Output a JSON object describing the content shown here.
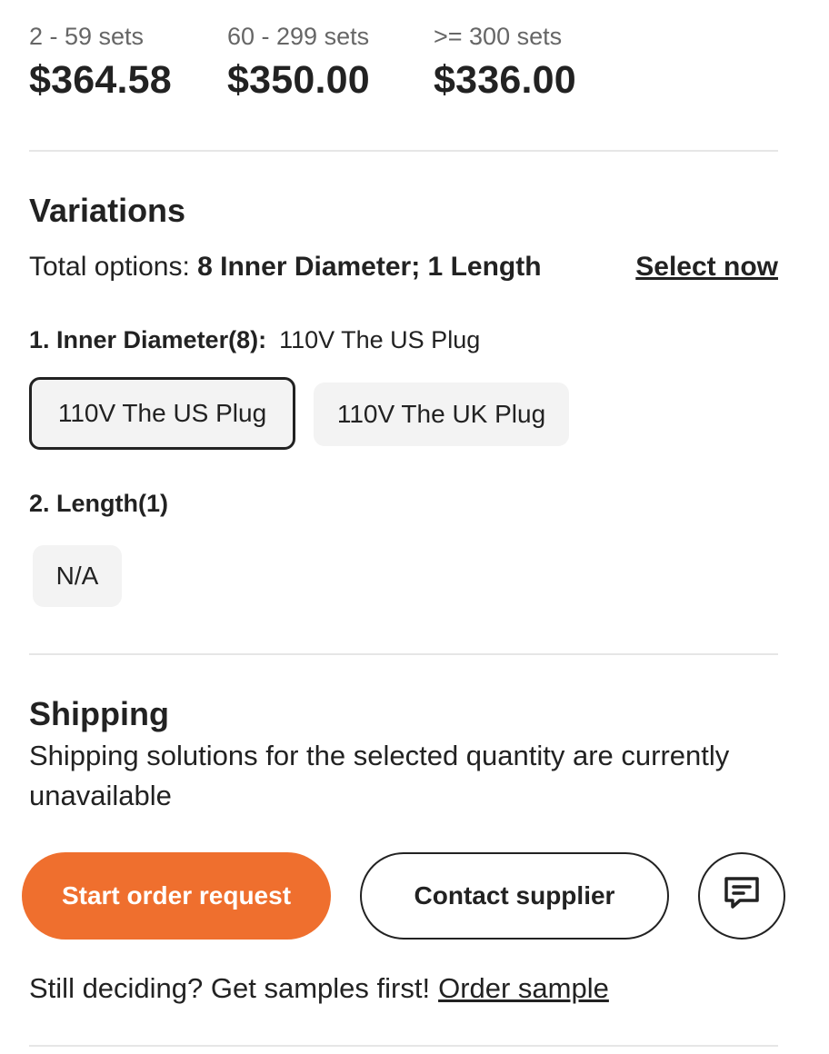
{
  "price_tiers": [
    {
      "quantity": "2 - 59 sets",
      "price": "$364.58"
    },
    {
      "quantity": "60 - 299 sets",
      "price": "$350.00"
    },
    {
      "quantity": ">= 300 sets",
      "price": "$336.00"
    }
  ],
  "variations": {
    "title": "Variations",
    "total_label": "Total options:",
    "total_value": "8 Inner Diameter; 1 Length",
    "select_now": "Select now",
    "attributes": [
      {
        "label": "1. Inner Diameter(8):",
        "selected": "110V The US Plug",
        "options": [
          "110V The US Plug",
          "110V The UK Plug"
        ]
      },
      {
        "label": "2. Length(1)",
        "selected": "",
        "options": [
          "N/A"
        ]
      }
    ]
  },
  "shipping": {
    "title": "Shipping",
    "message": "Shipping solutions for the selected quantity are currently unavailable"
  },
  "actions": {
    "start_order": "Start order request",
    "contact_supplier": "Contact supplier",
    "chat_icon": "chat-icon",
    "accent_color": "#ef6f2e"
  },
  "samples": {
    "prompt": "Still deciding? Get samples first!",
    "link": "Order sample"
  }
}
